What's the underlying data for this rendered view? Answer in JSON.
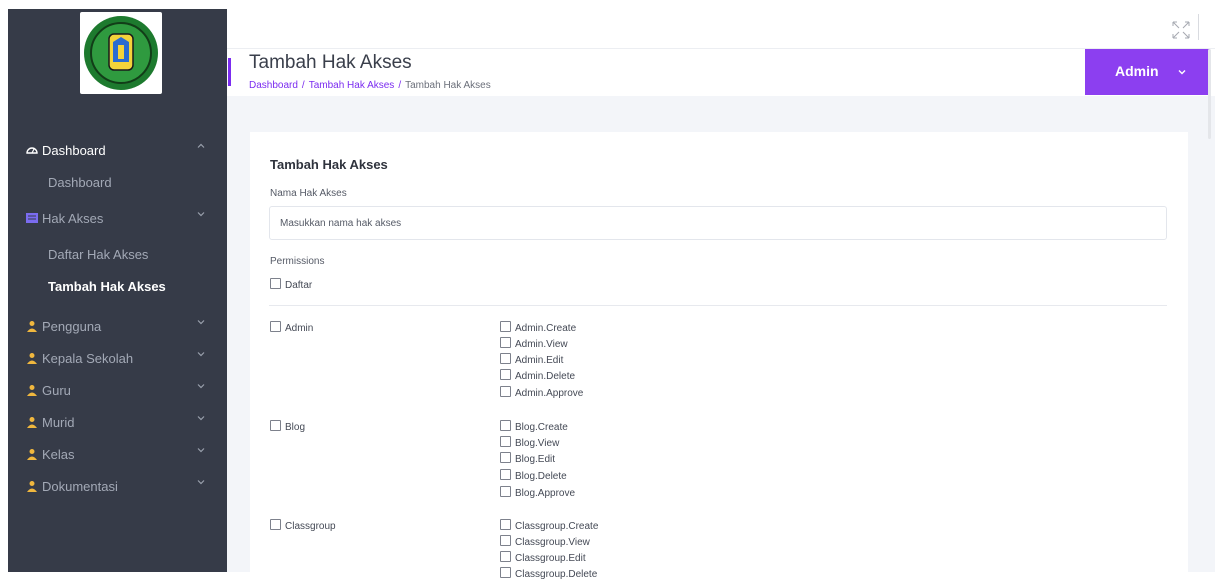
{
  "sidebar": {
    "items": [
      {
        "label": "Dashboard",
        "icon": "dashboard-icon"
      },
      {
        "label": "Dashboard"
      },
      {
        "label": "Hak Akses",
        "icon": "list-icon"
      },
      {
        "label": "Daftar Hak Akses"
      },
      {
        "label": "Tambah Hak Akses"
      },
      {
        "label": "Pengguna",
        "icon": "user-icon"
      },
      {
        "label": "Kepala Sekolah",
        "icon": "user-icon"
      },
      {
        "label": "Guru",
        "icon": "user-icon"
      },
      {
        "label": "Murid",
        "icon": "user-icon"
      },
      {
        "label": "Kelas",
        "icon": "user-icon"
      },
      {
        "label": "Dokumentasi",
        "icon": "user-icon"
      }
    ]
  },
  "header": {
    "title": "Tambah Hak Akses",
    "breadcrumb": [
      "Dashboard",
      "Tambah Hak Akses",
      "Tambah Hak Akses"
    ],
    "user_label": "Admin"
  },
  "form": {
    "title": "Tambah Hak Akses",
    "name_label": "Nama Hak Akses",
    "name_placeholder": "Masukkan nama hak akses",
    "permissions_label": "Permissions",
    "select_all_label": "Daftar",
    "groups": [
      {
        "name": "Admin",
        "perms": [
          "Admin.Create",
          "Admin.View",
          "Admin.Edit",
          "Admin.Delete",
          "Admin.Approve"
        ]
      },
      {
        "name": "Blog",
        "perms": [
          "Blog.Create",
          "Blog.View",
          "Blog.Edit",
          "Blog.Delete",
          "Blog.Approve"
        ]
      },
      {
        "name": "Classgroup",
        "perms": [
          "Classgroup.Create",
          "Classgroup.View",
          "Classgroup.Edit",
          "Classgroup.Delete"
        ]
      }
    ]
  },
  "colors": {
    "sidebar_bg": "#363b48",
    "accent": "#8c3ff0",
    "link": "#7b2cf0",
    "user_icon": "#f0b73e"
  }
}
